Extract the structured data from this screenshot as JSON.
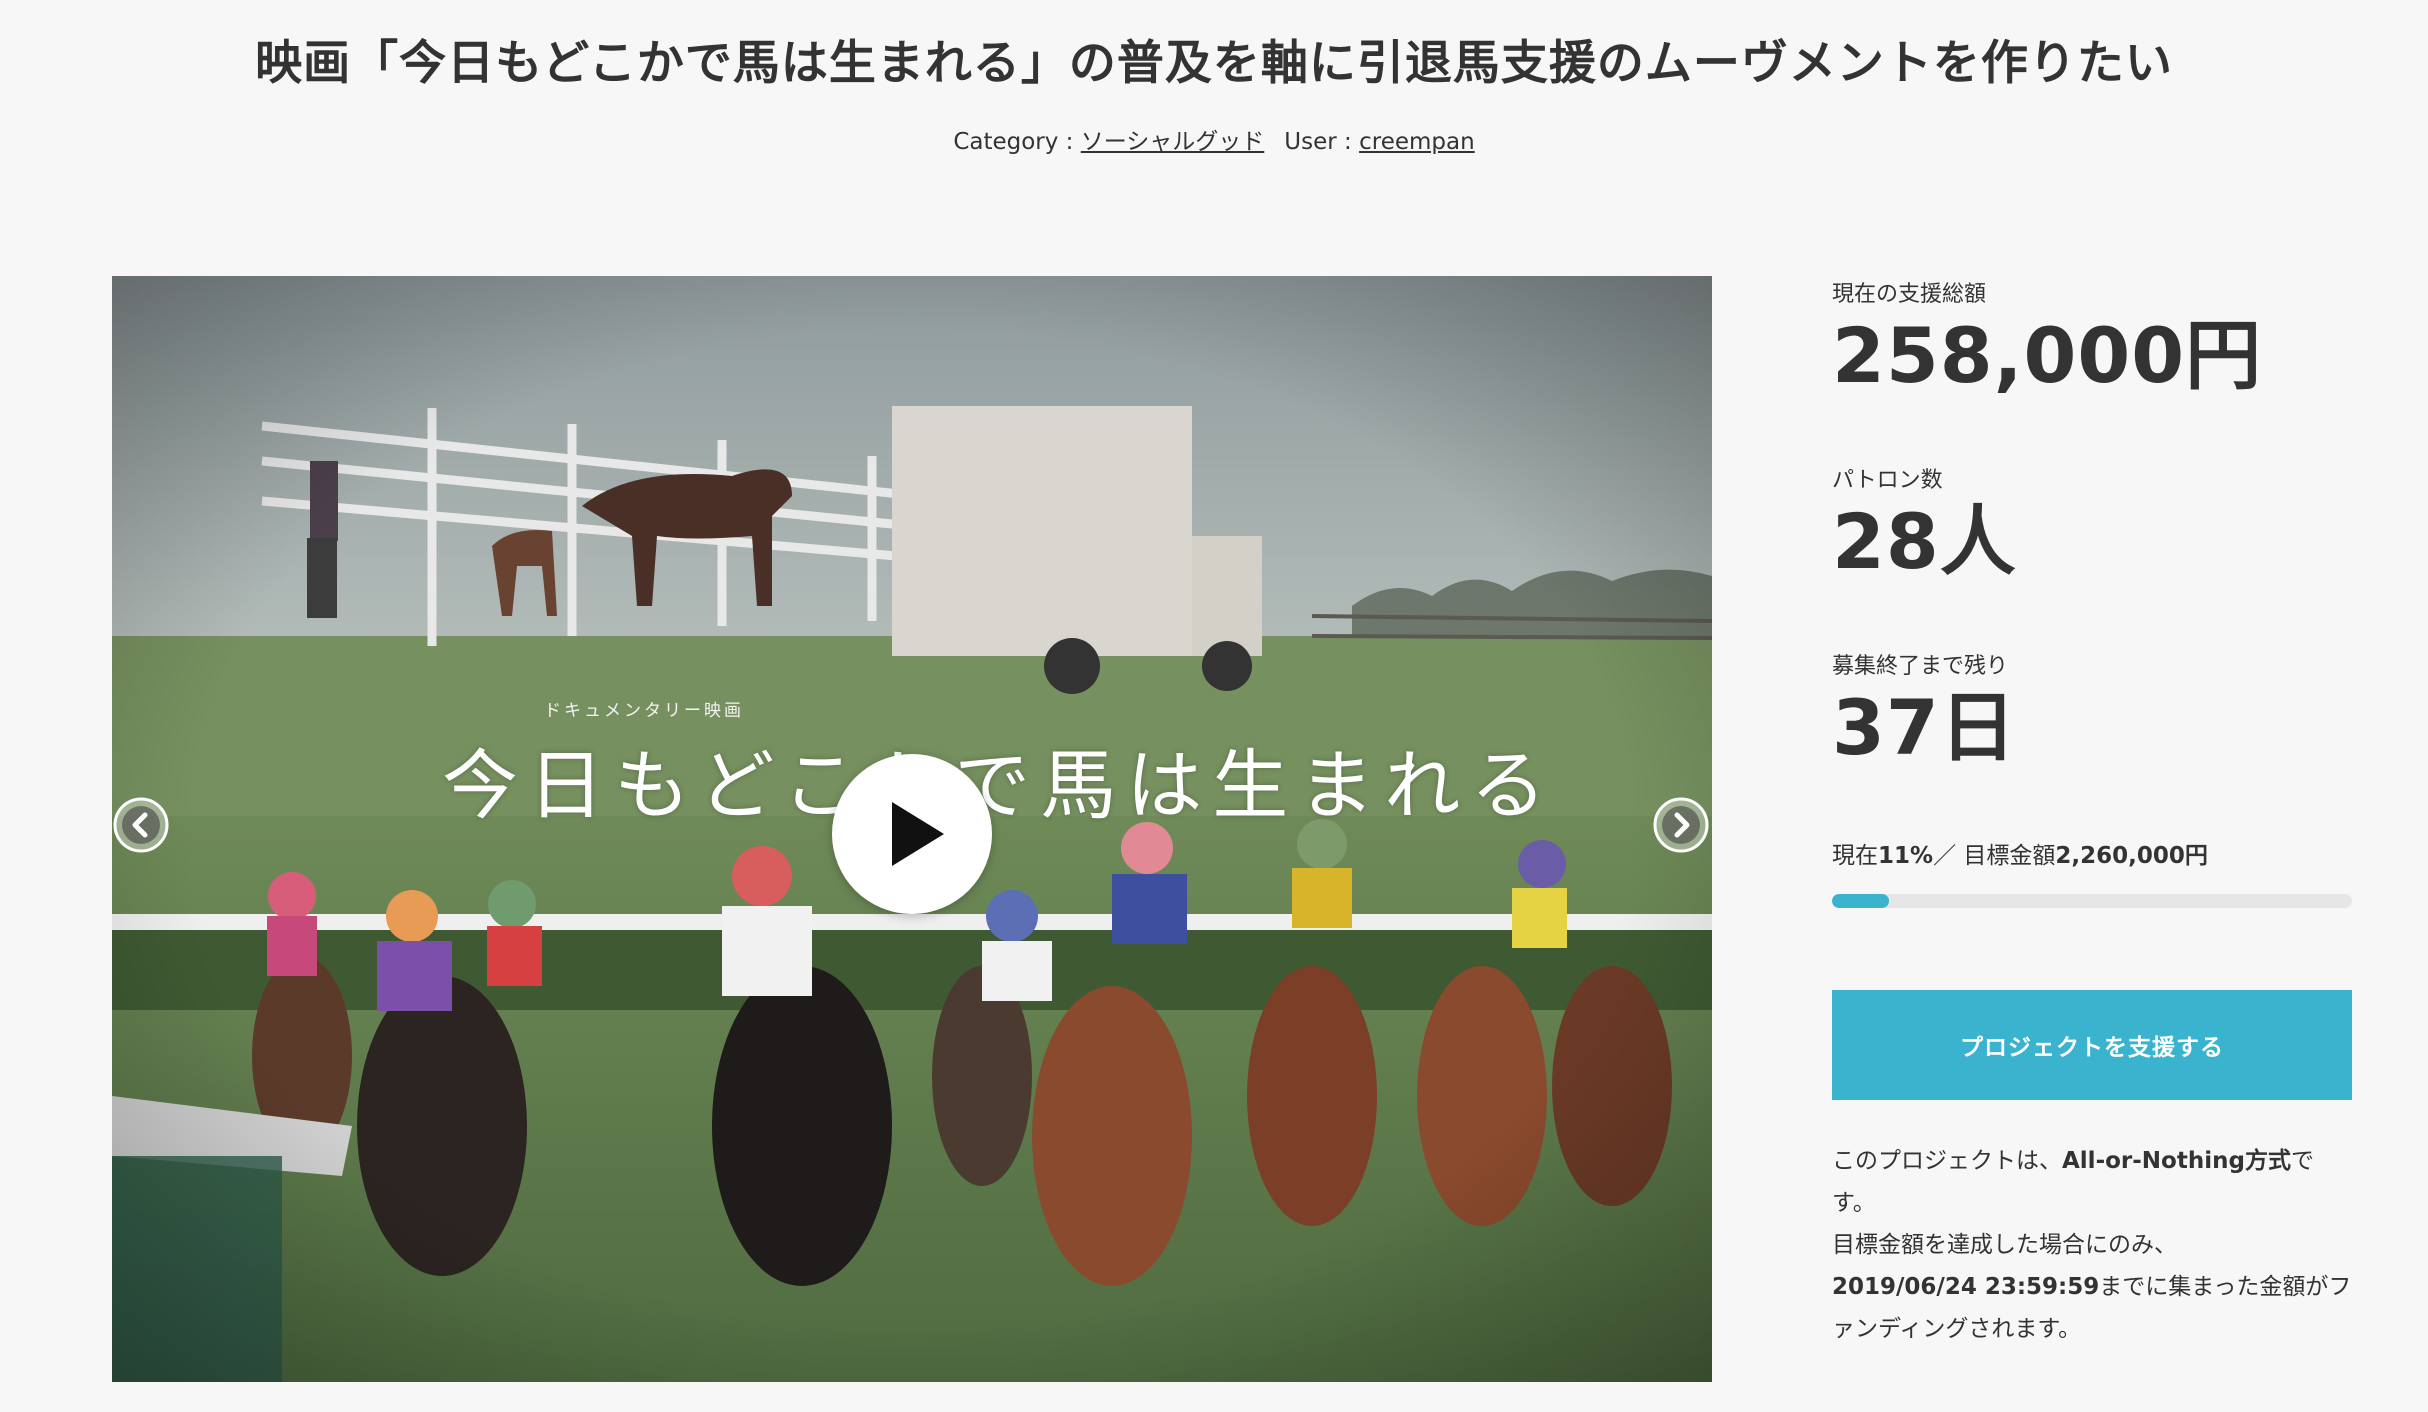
{
  "header": {
    "title": "映画「今日もどこかで馬は生まれる」の普及を軸に引退馬支援のムーヴメントを作りたい",
    "category_label": "Category : ",
    "category_value": "ソーシャルグッド",
    "user_label": "User : ",
    "user_value": "creempan"
  },
  "media": {
    "film_subtitle": "ドキュメンタリー映画",
    "film_title": "今日もどこかで馬は生まれる",
    "play_icon": "play-icon",
    "prev_icon": "chevron-left-icon",
    "next_icon": "chevron-right-icon"
  },
  "stats": {
    "total_label": "現在の支援総額",
    "total_value": "258,000円",
    "patrons_label": "パトロン数",
    "patrons_value": "28人",
    "remaining_label": "募集終了まで残り",
    "remaining_value": "37日"
  },
  "progress": {
    "prefix": "現在",
    "percent_text": "11%",
    "separator": "／ 目標金額",
    "goal_text": "2,260,000円",
    "fraction": 0.11
  },
  "support_button": {
    "label": "プロジェクトを支援する"
  },
  "note": {
    "line1_a": "このプロジェクトは、",
    "line1_b": "All-or-Nothing方式",
    "line1_c": "です。",
    "line2": "目標金額を達成した場合にのみ、",
    "line3_a": "2019/06/24 23:59:59",
    "line3_b": "までに集まった金額がファンディングされます。"
  },
  "colors": {
    "accent": "#3ab3ce",
    "background": "#f7f7f7",
    "text": "#333333"
  }
}
